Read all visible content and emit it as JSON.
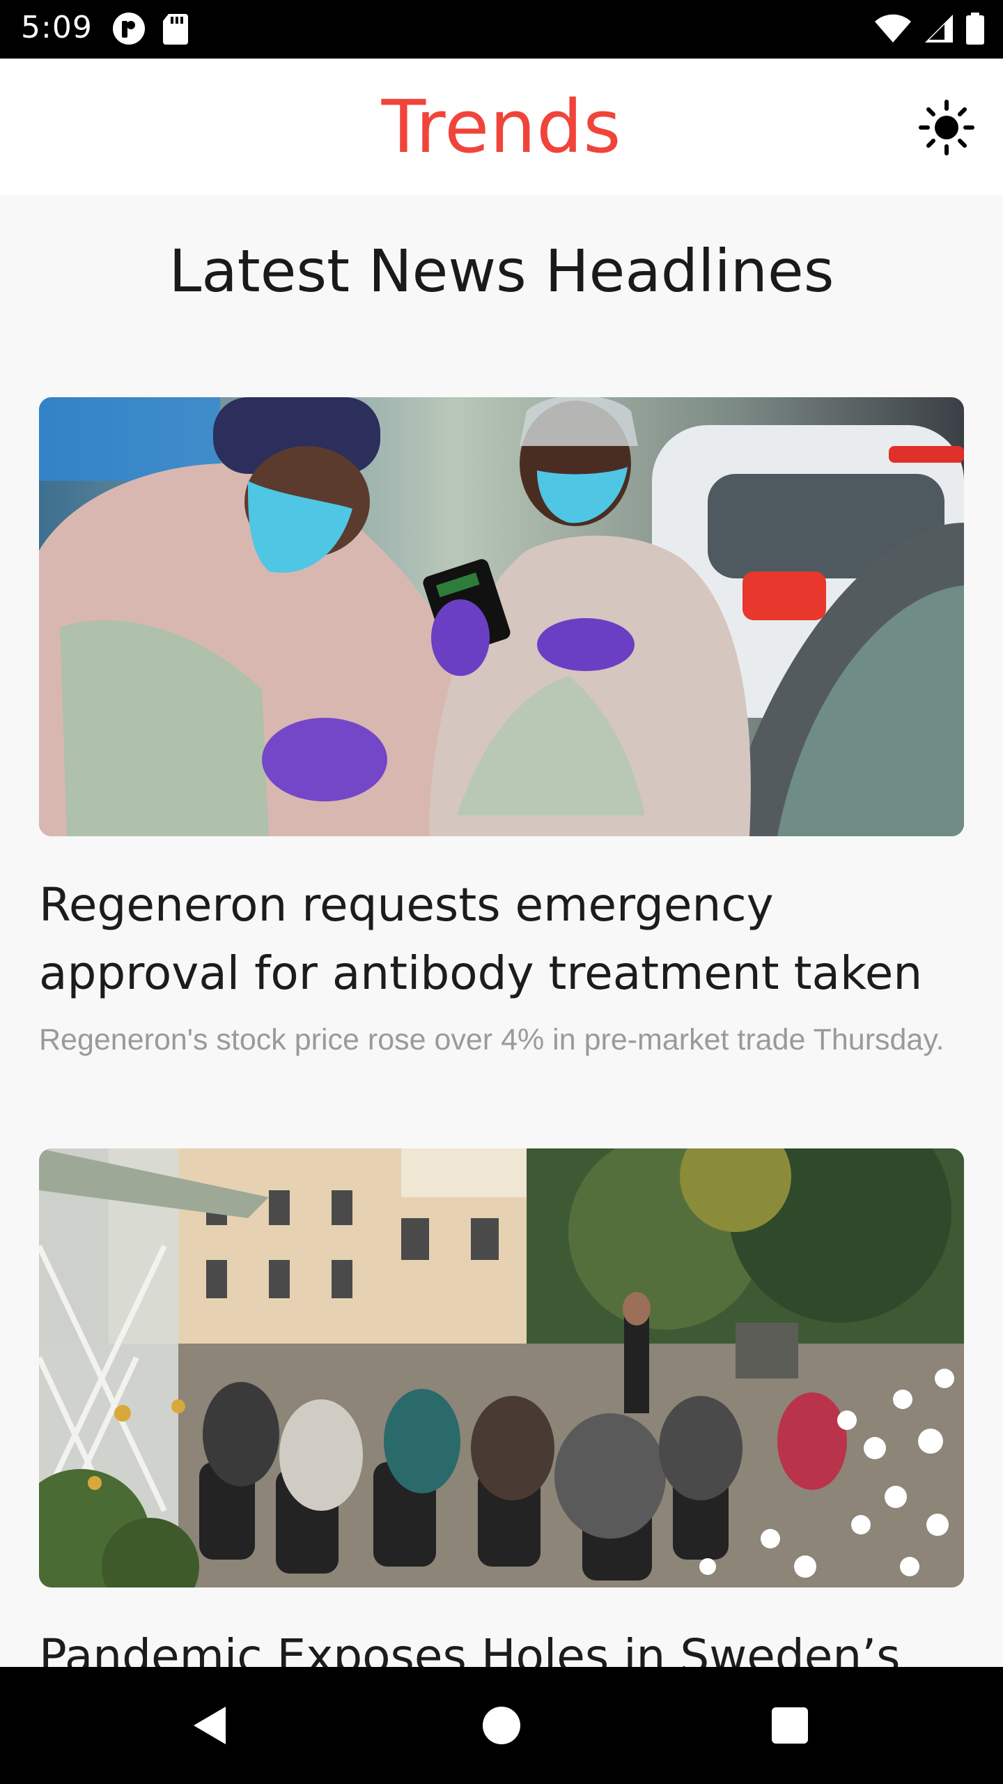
{
  "status_bar": {
    "time": "5:09",
    "left_icons": [
      "app-notification-icon",
      "sd-card-icon"
    ],
    "right_icons": [
      "wifi-icon",
      "cellular-signal-icon",
      "battery-icon"
    ]
  },
  "app_bar": {
    "title": "Trends",
    "title_color": "#f0443a",
    "theme_toggle_icon": "sun-icon"
  },
  "main": {
    "heading": "Latest News Headlines",
    "articles": [
      {
        "image": "healthcare-workers-ppe-photo",
        "title": "Regeneron requests emergency approval for antibody treatment taken",
        "description": "Regeneron's stock price rose over 4% in pre-market trade Thursday."
      },
      {
        "image": "elderly-garden-concert-photo",
        "title": "Pandemic Exposes Holes in Sweden’s",
        "description": ""
      }
    ]
  },
  "nav_bar": {
    "buttons": [
      "back-icon",
      "home-icon",
      "recents-icon"
    ]
  }
}
